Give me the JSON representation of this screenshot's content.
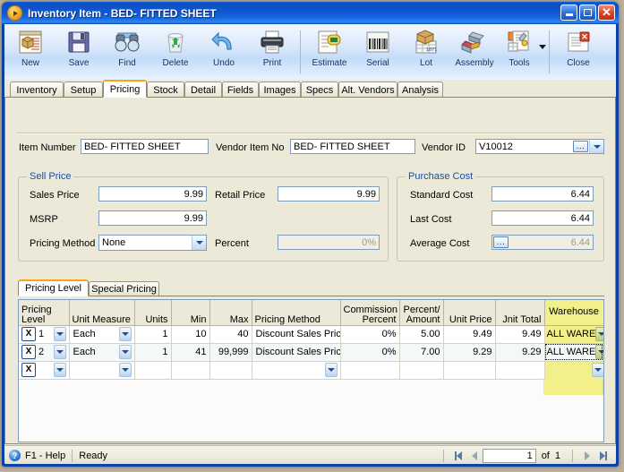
{
  "window": {
    "title_main": "Inventory Item",
    "title_sep": " - ",
    "title_item": "BED- FITTED SHEET",
    "icon": "app-arrow-icon",
    "minimize_label": "Minimize",
    "maximize_label": "Maximize",
    "close_label": "Close"
  },
  "toolbar": {
    "buttons": [
      {
        "label": "New",
        "icon": "new-item-icon"
      },
      {
        "label": "Save",
        "icon": "floppy-disk-icon"
      },
      {
        "label": "Find",
        "icon": "binoculars-icon"
      },
      {
        "label": "Delete",
        "icon": "recycle-bin-icon"
      },
      {
        "label": "Undo",
        "icon": "undo-arrow-icon"
      },
      {
        "label": "Print",
        "icon": "printer-icon"
      },
      {
        "label": "Estimate",
        "icon": "estimate-tag-icon"
      },
      {
        "label": "Serial",
        "icon": "barcode-icon"
      },
      {
        "label": "Lot",
        "icon": "lot-box-icon"
      },
      {
        "label": "Assembly",
        "icon": "assembly-boxes-icon"
      },
      {
        "label": "Tools",
        "icon": "tools-wrench-icon"
      },
      {
        "label": "Close",
        "icon": "close-document-icon"
      }
    ],
    "tools_dropdown_icon": "caret-down-icon"
  },
  "tabs": [
    {
      "label": "Inventory",
      "active": false
    },
    {
      "label": "Setup",
      "active": false
    },
    {
      "label": "Pricing",
      "active": true
    },
    {
      "label": "Stock",
      "active": false
    },
    {
      "label": "Detail",
      "active": false
    },
    {
      "label": "Fields",
      "active": false
    },
    {
      "label": "Images",
      "active": false
    },
    {
      "label": "Specs",
      "active": false
    },
    {
      "label": "Alt. Vendors",
      "active": false
    },
    {
      "label": "Analysis",
      "active": false
    }
  ],
  "header_fields": {
    "item_number_label": "Item Number",
    "item_number_value": "BED- FITTED SHEET",
    "vendor_item_no_label": "Vendor Item No",
    "vendor_item_no_value": "BED- FITTED SHEET",
    "vendor_id_label": "Vendor ID",
    "vendor_id_value": "V10012",
    "lookup_glyph": "...",
    "dropdown_icon": "chevron-down-icon"
  },
  "sell_price": {
    "title": "Sell Price",
    "sales_price_label": "Sales Price",
    "sales_price_value": "9.99",
    "retail_price_label": "Retail Price",
    "retail_price_value": "9.99",
    "msrp_label": "MSRP",
    "msrp_value": "9.99",
    "pricing_method_label": "Pricing Method",
    "pricing_method_value": "None",
    "percent_label": "Percent",
    "percent_value": "0%"
  },
  "purchase_cost": {
    "title": "Purchase Cost",
    "standard_cost_label": "Standard Cost",
    "standard_cost_value": "6.44",
    "last_cost_label": "Last Cost",
    "last_cost_value": "6.44",
    "average_cost_label": "Average Cost",
    "average_cost_value": "6.44",
    "average_cost_button_glyph": "..."
  },
  "inner_tabs": [
    {
      "label": "Pricing Level",
      "active": true
    },
    {
      "label": "Special Pricing",
      "active": false
    }
  ],
  "grid": {
    "columns": [
      {
        "key": "level",
        "header": "Pricing\nLevel",
        "align": "left"
      },
      {
        "key": "unit",
        "header": "Unit Measure",
        "align": "left"
      },
      {
        "key": "units",
        "header": "Units",
        "align": "right"
      },
      {
        "key": "min",
        "header": "Min",
        "align": "right"
      },
      {
        "key": "max",
        "header": "Max",
        "align": "right"
      },
      {
        "key": "method",
        "header": "Pricing Method",
        "align": "left"
      },
      {
        "key": "commission",
        "header": "Commission\nPercent",
        "align": "right"
      },
      {
        "key": "percent",
        "header": "Percent/\nAmount",
        "align": "right"
      },
      {
        "key": "unitprice",
        "header": "Unit Price",
        "align": "right"
      },
      {
        "key": "unittotal",
        "header": "Jnit Total",
        "align": "right"
      },
      {
        "key": "warehouse",
        "header": "Warehouse",
        "align": "center"
      }
    ],
    "rows": [
      {
        "delete_glyph": "X",
        "level": "1",
        "unit": "Each",
        "units": "1",
        "min": "10",
        "max": "40",
        "method": "Discount Sales Pric",
        "commission": "0%",
        "percent": "5.00",
        "unitprice": "9.49",
        "unittotal": "9.49",
        "warehouse": "ALL WARE",
        "warehouse_focused": false
      },
      {
        "delete_glyph": "X",
        "level": "2",
        "unit": "Each",
        "units": "1",
        "min": "41",
        "max": "99,999",
        "method": "Discount Sales Pric",
        "commission": "0%",
        "percent": "7.00",
        "unitprice": "9.29",
        "unittotal": "9.29",
        "warehouse": "ALL WARE",
        "warehouse_focused": true
      },
      {
        "delete_glyph": "X",
        "level": "",
        "unit": "",
        "units": "",
        "min": "",
        "max": "",
        "method": "",
        "commission": "",
        "percent": "",
        "unitprice": "",
        "unittotal": "",
        "warehouse": "",
        "warehouse_focused": false
      }
    ]
  },
  "statusbar": {
    "help_icon": "help-question-icon",
    "help_label": "F1 - Help",
    "state": "Ready",
    "first_icon": "first-record-icon",
    "prev_icon": "previous-record-icon",
    "record_value": "1",
    "of_label": "of",
    "record_total": "1",
    "next_icon": "next-record-icon",
    "last_icon": "last-record-icon"
  },
  "colors": {
    "title_blue": "#0b4fc4",
    "accent_orange": "#f5a518",
    "warehouse_yellow": "#f2f08a",
    "group_title_blue": "#1a4fa0",
    "face": "#ece9d8"
  }
}
